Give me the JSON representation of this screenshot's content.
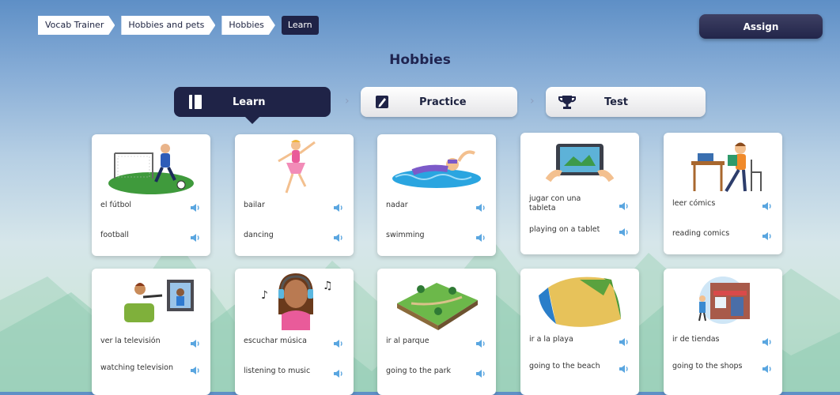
{
  "breadcrumb": [
    "Vocab Trainer",
    "Hobbies and pets",
    "Hobbies",
    "Learn"
  ],
  "assign_label": "Assign",
  "page_title": "Hobbies",
  "tabs": [
    {
      "label": "Learn",
      "icon": "book-icon",
      "active": true
    },
    {
      "label": "Practice",
      "icon": "pencil-icon",
      "active": false
    },
    {
      "label": "Test",
      "icon": "trophy-icon",
      "active": false
    }
  ],
  "cards": [
    {
      "spanish": "el fútbol",
      "english": "football",
      "image": "football-picture"
    },
    {
      "spanish": "bailar",
      "english": "dancing",
      "image": "dancer-picture"
    },
    {
      "spanish": "nadar",
      "english": "swimming",
      "image": "swimmer-picture"
    },
    {
      "spanish": "jugar con una tableta",
      "english": "playing on a tablet",
      "image": "tablet-picture"
    },
    {
      "spanish": "leer cómics",
      "english": "reading comics",
      "image": "reading-picture"
    },
    {
      "spanish": "ver la televisión",
      "english": "watching television",
      "image": "television-picture"
    },
    {
      "spanish": "escuchar música",
      "english": "listening to music",
      "image": "music-picture"
    },
    {
      "spanish": "ir al parque",
      "english": "going to the park",
      "image": "park-picture"
    },
    {
      "spanish": "ir a la playa",
      "english": "going to the beach",
      "image": "beach-picture"
    },
    {
      "spanish": "ir de tiendas",
      "english": "going to the shops",
      "image": "shops-picture"
    }
  ],
  "colors": {
    "navy": "#1f2347",
    "speaker": "#5aa6e0"
  }
}
